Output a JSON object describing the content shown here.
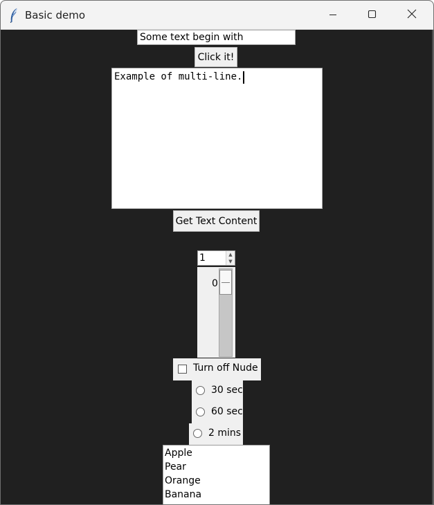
{
  "window": {
    "title": "Basic demo"
  },
  "titlebar": {
    "feather_icon": "feather-icon",
    "minimize_icon": "minimize-icon",
    "maximize_icon": "maximize-icon",
    "close_icon": "close-icon"
  },
  "entry": {
    "value": "Some text begin with"
  },
  "buttons": {
    "click_label": "Click it!",
    "get_text_label": "Get Text Content"
  },
  "text_area": {
    "value": "Example of multi-line."
  },
  "spinbox": {
    "value": "1",
    "up_icon": "up-arrow-icon",
    "down_icon": "down-arrow-icon"
  },
  "scale": {
    "value": "0",
    "position_fraction": 0
  },
  "checkbox": {
    "label": "Turn off Nude",
    "checked": false
  },
  "radio_options": [
    {
      "label": "30 sec",
      "checked": false
    },
    {
      "label": "60 sec",
      "checked": false
    },
    {
      "label": "2 mins",
      "checked": false
    }
  ],
  "listbox": {
    "items": [
      "Apple",
      "Pear",
      "Orange",
      "Banana"
    ]
  },
  "colors": {
    "window_background": "#202020",
    "title_bar": "#f3f3f3",
    "control_background": "#f0f0f0",
    "input_background": "#ffffff"
  }
}
